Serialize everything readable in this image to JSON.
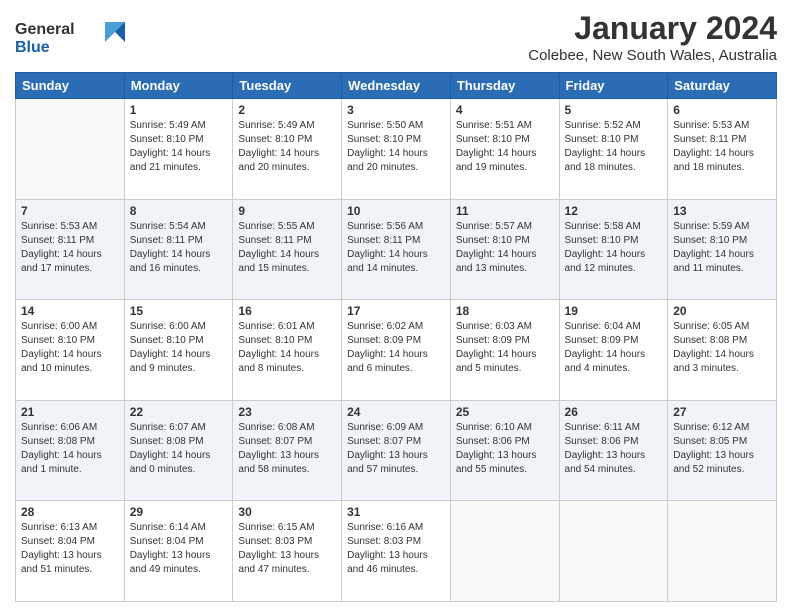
{
  "logo": {
    "line1": "General",
    "line2": "Blue"
  },
  "title": "January 2024",
  "subtitle": "Colebee, New South Wales, Australia",
  "days_of_week": [
    "Sunday",
    "Monday",
    "Tuesday",
    "Wednesday",
    "Thursday",
    "Friday",
    "Saturday"
  ],
  "weeks": [
    [
      {
        "day": "",
        "info": ""
      },
      {
        "day": "1",
        "info": "Sunrise: 5:49 AM\nSunset: 8:10 PM\nDaylight: 14 hours\nand 21 minutes."
      },
      {
        "day": "2",
        "info": "Sunrise: 5:49 AM\nSunset: 8:10 PM\nDaylight: 14 hours\nand 20 minutes."
      },
      {
        "day": "3",
        "info": "Sunrise: 5:50 AM\nSunset: 8:10 PM\nDaylight: 14 hours\nand 20 minutes."
      },
      {
        "day": "4",
        "info": "Sunrise: 5:51 AM\nSunset: 8:10 PM\nDaylight: 14 hours\nand 19 minutes."
      },
      {
        "day": "5",
        "info": "Sunrise: 5:52 AM\nSunset: 8:10 PM\nDaylight: 14 hours\nand 18 minutes."
      },
      {
        "day": "6",
        "info": "Sunrise: 5:53 AM\nSunset: 8:11 PM\nDaylight: 14 hours\nand 18 minutes."
      }
    ],
    [
      {
        "day": "7",
        "info": "Sunrise: 5:53 AM\nSunset: 8:11 PM\nDaylight: 14 hours\nand 17 minutes."
      },
      {
        "day": "8",
        "info": "Sunrise: 5:54 AM\nSunset: 8:11 PM\nDaylight: 14 hours\nand 16 minutes."
      },
      {
        "day": "9",
        "info": "Sunrise: 5:55 AM\nSunset: 8:11 PM\nDaylight: 14 hours\nand 15 minutes."
      },
      {
        "day": "10",
        "info": "Sunrise: 5:56 AM\nSunset: 8:11 PM\nDaylight: 14 hours\nand 14 minutes."
      },
      {
        "day": "11",
        "info": "Sunrise: 5:57 AM\nSunset: 8:10 PM\nDaylight: 14 hours\nand 13 minutes."
      },
      {
        "day": "12",
        "info": "Sunrise: 5:58 AM\nSunset: 8:10 PM\nDaylight: 14 hours\nand 12 minutes."
      },
      {
        "day": "13",
        "info": "Sunrise: 5:59 AM\nSunset: 8:10 PM\nDaylight: 14 hours\nand 11 minutes."
      }
    ],
    [
      {
        "day": "14",
        "info": "Sunrise: 6:00 AM\nSunset: 8:10 PM\nDaylight: 14 hours\nand 10 minutes."
      },
      {
        "day": "15",
        "info": "Sunrise: 6:00 AM\nSunset: 8:10 PM\nDaylight: 14 hours\nand 9 minutes."
      },
      {
        "day": "16",
        "info": "Sunrise: 6:01 AM\nSunset: 8:10 PM\nDaylight: 14 hours\nand 8 minutes."
      },
      {
        "day": "17",
        "info": "Sunrise: 6:02 AM\nSunset: 8:09 PM\nDaylight: 14 hours\nand 6 minutes."
      },
      {
        "day": "18",
        "info": "Sunrise: 6:03 AM\nSunset: 8:09 PM\nDaylight: 14 hours\nand 5 minutes."
      },
      {
        "day": "19",
        "info": "Sunrise: 6:04 AM\nSunset: 8:09 PM\nDaylight: 14 hours\nand 4 minutes."
      },
      {
        "day": "20",
        "info": "Sunrise: 6:05 AM\nSunset: 8:08 PM\nDaylight: 14 hours\nand 3 minutes."
      }
    ],
    [
      {
        "day": "21",
        "info": "Sunrise: 6:06 AM\nSunset: 8:08 PM\nDaylight: 14 hours\nand 1 minute."
      },
      {
        "day": "22",
        "info": "Sunrise: 6:07 AM\nSunset: 8:08 PM\nDaylight: 14 hours\nand 0 minutes."
      },
      {
        "day": "23",
        "info": "Sunrise: 6:08 AM\nSunset: 8:07 PM\nDaylight: 13 hours\nand 58 minutes."
      },
      {
        "day": "24",
        "info": "Sunrise: 6:09 AM\nSunset: 8:07 PM\nDaylight: 13 hours\nand 57 minutes."
      },
      {
        "day": "25",
        "info": "Sunrise: 6:10 AM\nSunset: 8:06 PM\nDaylight: 13 hours\nand 55 minutes."
      },
      {
        "day": "26",
        "info": "Sunrise: 6:11 AM\nSunset: 8:06 PM\nDaylight: 13 hours\nand 54 minutes."
      },
      {
        "day": "27",
        "info": "Sunrise: 6:12 AM\nSunset: 8:05 PM\nDaylight: 13 hours\nand 52 minutes."
      }
    ],
    [
      {
        "day": "28",
        "info": "Sunrise: 6:13 AM\nSunset: 8:04 PM\nDaylight: 13 hours\nand 51 minutes."
      },
      {
        "day": "29",
        "info": "Sunrise: 6:14 AM\nSunset: 8:04 PM\nDaylight: 13 hours\nand 49 minutes."
      },
      {
        "day": "30",
        "info": "Sunrise: 6:15 AM\nSunset: 8:03 PM\nDaylight: 13 hours\nand 47 minutes."
      },
      {
        "day": "31",
        "info": "Sunrise: 6:16 AM\nSunset: 8:03 PM\nDaylight: 13 hours\nand 46 minutes."
      },
      {
        "day": "",
        "info": ""
      },
      {
        "day": "",
        "info": ""
      },
      {
        "day": "",
        "info": ""
      }
    ]
  ]
}
